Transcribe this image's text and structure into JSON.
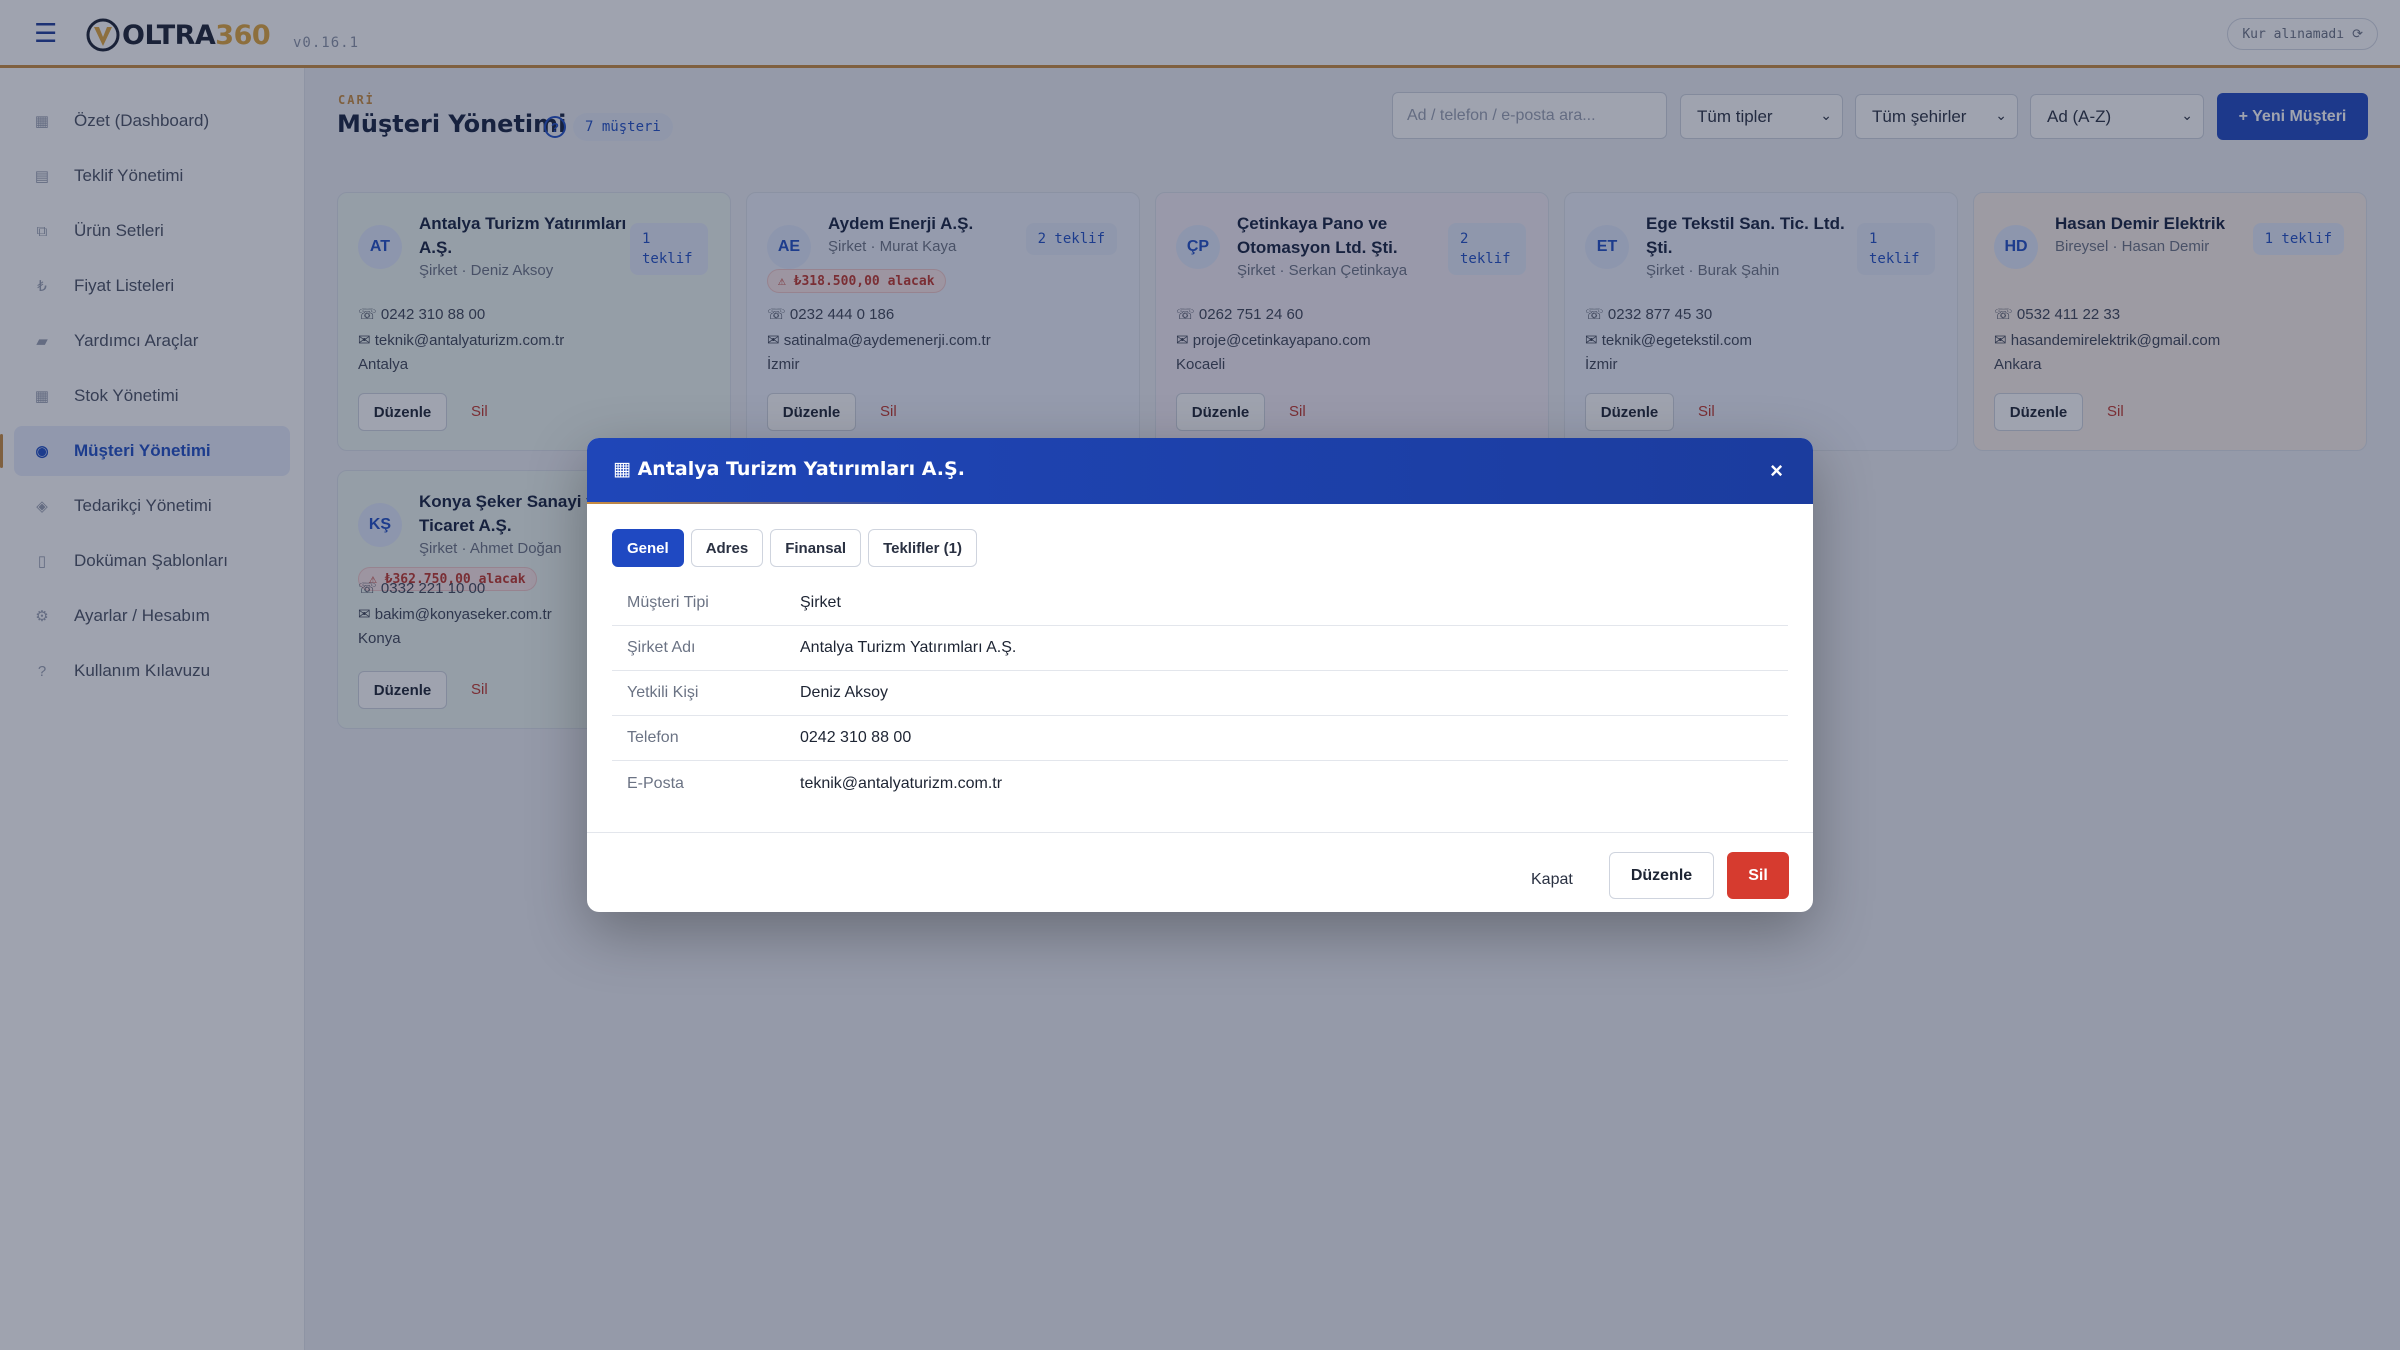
{
  "app": {
    "logo_text": "OLTRA",
    "logo_num": "360",
    "version": "v0.16.1",
    "fx_status": "Kur alınamadı",
    "fx_icon": "refresh-icon",
    "colors": {
      "brand_blue": "#1f49c2",
      "accent_gold": "#c98c3f",
      "danger": "#d63b2f"
    }
  },
  "sidebar": {
    "items": [
      {
        "label": "Özet (Dashboard)",
        "icon": "grid-icon",
        "glyph": "▦",
        "active": false
      },
      {
        "label": "Teklif Yönetimi",
        "icon": "document-icon",
        "glyph": "▤",
        "active": false
      },
      {
        "label": "Ürün Setleri",
        "icon": "box-icon",
        "glyph": "⧉",
        "active": false
      },
      {
        "label": "Fiyat Listeleri",
        "icon": "lira-icon",
        "glyph": "₺",
        "active": false
      },
      {
        "label": "Yardımcı Araçlar",
        "icon": "toolbox-icon",
        "glyph": "▰",
        "active": false
      },
      {
        "label": "Stok Yönetimi",
        "icon": "stock-icon",
        "glyph": "▦",
        "active": false
      },
      {
        "label": "Müşteri Yönetimi",
        "icon": "customer-icon",
        "glyph": "◉",
        "active": true
      },
      {
        "label": "Tedarikçi Yönetimi",
        "icon": "supplier-icon",
        "glyph": "◈",
        "active": false
      },
      {
        "label": "Doküman Şablonları",
        "icon": "template-icon",
        "glyph": "▯",
        "active": false
      },
      {
        "label": "Ayarlar / Hesabım",
        "icon": "gear-icon",
        "glyph": "⚙",
        "active": false
      },
      {
        "label": "Kullanım Kılavuzu",
        "icon": "help-icon",
        "glyph": "?",
        "active": false
      }
    ]
  },
  "header": {
    "kicker": "CARİ",
    "title": "Müşteri Yönetimi",
    "help": "?",
    "count": "7 müşteri",
    "search_placeholder": "Ad / telefon / e-posta ara...",
    "filter_type": "Tüm tipler",
    "filter_city": "Tüm şehirler",
    "sort": "Ad (A-Z)",
    "new_button": "+ Yeni Müşteri"
  },
  "cards": [
    {
      "initials": "AT",
      "name": "Antalya Turizm Yatırımları A.Ş.",
      "sub": "Şirket · Deniz Aksoy",
      "offers": "1 teklif",
      "debt": "",
      "phone": "☏ 0242 310 88 00",
      "email": "✉ teknik@antalyaturizm.com.tr",
      "city": "Antalya",
      "edit": "Düzenle",
      "delete": "Sil",
      "tint": "#eef6f1"
    },
    {
      "initials": "AE",
      "name": "Aydem Enerji A.Ş.",
      "sub": "Şirket · Murat Kaya",
      "offers": "2 teklif",
      "debt": "⚠ ₺318.500,00 alacak",
      "phone": "☏ 0232 444 0 186",
      "email": "✉ satinalma@aydemenerji.com.tr",
      "city": "İzmir",
      "edit": "Düzenle",
      "delete": "Sil",
      "tint": "#eef2fb"
    },
    {
      "initials": "ÇP",
      "name": "Çetinkaya Pano ve Otomasyon Ltd. Şti.",
      "sub": "Şirket · Serkan Çetinkaya",
      "offers": "2 teklif",
      "debt": "",
      "phone": "☏ 0262 751 24 60",
      "email": "✉ proje@cetinkayapano.com",
      "city": "Kocaeli",
      "edit": "Düzenle",
      "delete": "Sil",
      "tint": "#f5eef7"
    },
    {
      "initials": "ET",
      "name": "Ege Tekstil San. Tic. Ltd. Şti.",
      "sub": "Şirket · Burak Şahin",
      "offers": "1 teklif",
      "debt": "",
      "phone": "☏ 0232 877 45 30",
      "email": "✉ teknik@egetekstil.com",
      "city": "İzmir",
      "edit": "Düzenle",
      "delete": "Sil",
      "tint": "#eef2fb"
    },
    {
      "initials": "HD",
      "name": "Hasan Demir Elektrik",
      "sub": "Bireysel · Hasan Demir",
      "offers": "1 teklif",
      "debt": "",
      "phone": "☏ 0532 411 22 33",
      "email": "✉ hasandemirelektrik@gmail.com",
      "city": "Ankara",
      "edit": "Düzenle",
      "delete": "Sil",
      "tint": "#fbf1ea"
    },
    {
      "initials": "KŞ",
      "name": "Konya Şeker Sanayi ve Ticaret A.Ş.",
      "sub": "Şirket · Ahmet Doğan",
      "offers": "",
      "debt": "⚠ ₺362.750,00 alacak",
      "phone": "☏ 0332 221 10 00",
      "email": "✉ bakim@konyaseker.com.tr",
      "city": "Konya",
      "edit": "Düzenle",
      "delete": "Sil",
      "tint": "#eef6f1"
    }
  ],
  "modal": {
    "icon": "building-icon",
    "title": "Antalya Turizm Yatırımları A.Ş.",
    "close": "×",
    "tabs": [
      "Genel",
      "Adres",
      "Finansal",
      "Teklifler (1)"
    ],
    "rows": [
      {
        "label": "Müşteri Tipi",
        "value": "Şirket"
      },
      {
        "label": "Şirket Adı",
        "value": "Antalya Turizm Yatırımları A.Ş."
      },
      {
        "label": "Yetkili Kişi",
        "value": "Deniz Aksoy"
      },
      {
        "label": "Telefon",
        "value": "0242 310 88 00"
      },
      {
        "label": "E-Posta",
        "value": "teknik@antalyaturizm.com.tr"
      }
    ],
    "btn_close": "Kapat",
    "btn_edit": "Düzenle",
    "btn_delete": "Sil"
  }
}
